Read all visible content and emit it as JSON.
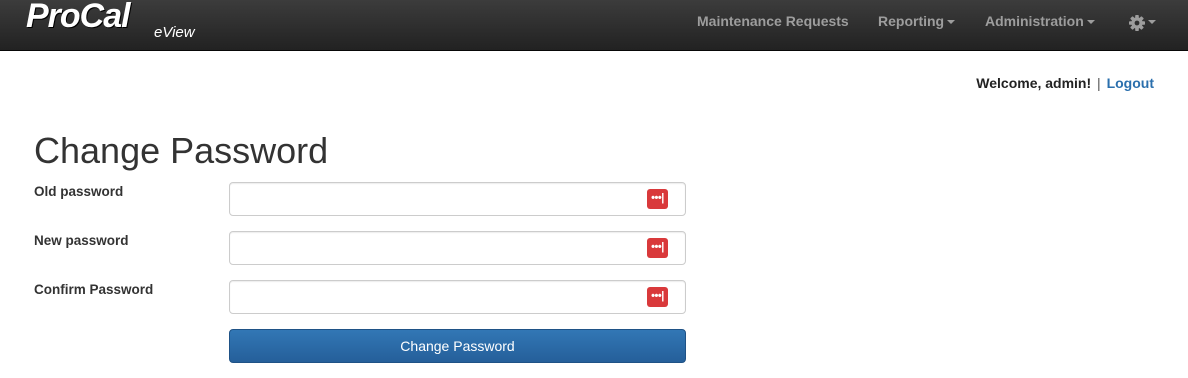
{
  "navbar": {
    "brand_main": "ProCal",
    "brand_sub": "eView",
    "items": [
      {
        "label": "Maintenance Requests",
        "dropdown": false
      },
      {
        "label": "Reporting",
        "dropdown": true
      },
      {
        "label": "Administration",
        "dropdown": true
      }
    ],
    "settings_icon": "gear-icon"
  },
  "header": {
    "welcome_text": "Welcome, admin!",
    "separator": "|",
    "logout_label": "Logout"
  },
  "form": {
    "title": "Change Password",
    "fields": [
      {
        "label": "Old password",
        "value": "",
        "icon": "password-manager-icon",
        "icon_glyph": "•••|"
      },
      {
        "label": "New password",
        "value": "",
        "icon": "password-manager-icon",
        "icon_glyph": "•••|"
      },
      {
        "label": "Confirm Password",
        "value": "",
        "icon": "password-manager-icon",
        "icon_glyph": "•••|"
      }
    ],
    "submit_label": "Change Password"
  },
  "colors": {
    "navbar_bg": "#222222",
    "nav_text": "#9d9d9d",
    "link": "#2a6fad",
    "button": "#2d6da8",
    "password_icon": "#d9393b"
  }
}
